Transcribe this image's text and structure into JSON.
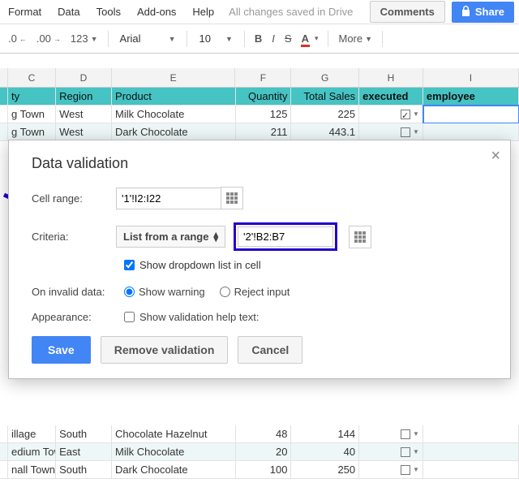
{
  "menubar": {
    "format": "Format",
    "data": "Data",
    "tools": "Tools",
    "addons": "Add-ons",
    "help": "Help",
    "status": "All changes saved in Drive",
    "comments": "Comments",
    "share": "Share"
  },
  "toolbar": {
    "dec0": ".0",
    "dec00": ".00",
    "num": "123",
    "font": "Arial",
    "size": "10",
    "bold": "B",
    "italic": "I",
    "strike": "S",
    "color": "A",
    "more": "More"
  },
  "columns": {
    "C": "C",
    "D": "D",
    "E": "E",
    "F": "F",
    "G": "G",
    "H": "H",
    "I": "I"
  },
  "headers": {
    "city": "ty",
    "region": "Region",
    "product": "Product",
    "qty": "Quantity",
    "total": "Total Sales",
    "executed": "executed",
    "employee": "employee"
  },
  "rows": [
    {
      "city": "g Town",
      "region": "West",
      "product": "Milk Chocolate",
      "qty": "125",
      "total": "225",
      "checked": true,
      "alt": false
    },
    {
      "city": "g Town",
      "region": "West",
      "product": "Dark Chocolate",
      "qty": "211",
      "total": "443.1",
      "checked": false,
      "alt": true
    }
  ],
  "bottom_rows": [
    {
      "city": "illage",
      "region": "South",
      "product": "Chocolate Hazelnut",
      "qty": "48",
      "total": "144",
      "checked": false,
      "alt": false
    },
    {
      "city": "edium Town",
      "region": "East",
      "product": "Milk Chocolate",
      "qty": "20",
      "total": "40",
      "checked": false,
      "alt": true
    },
    {
      "city": "nall Town",
      "region": "South",
      "product": "Dark Chocolate",
      "qty": "100",
      "total": "250",
      "checked": false,
      "alt": false
    }
  ],
  "dialog": {
    "title": "Data validation",
    "cell_range_label": "Cell range:",
    "cell_range_value": "'1'!I2:I22",
    "criteria_label": "Criteria:",
    "criteria_type": "List from a range",
    "criteria_value": "'2'!B2:B7",
    "show_dropdown": "Show dropdown list in cell",
    "on_invalid_label": "On invalid data:",
    "show_warning": "Show warning",
    "reject_input": "Reject input",
    "appearance_label": "Appearance:",
    "help_text": "Show validation help text:",
    "save": "Save",
    "remove": "Remove validation",
    "cancel": "Cancel"
  }
}
